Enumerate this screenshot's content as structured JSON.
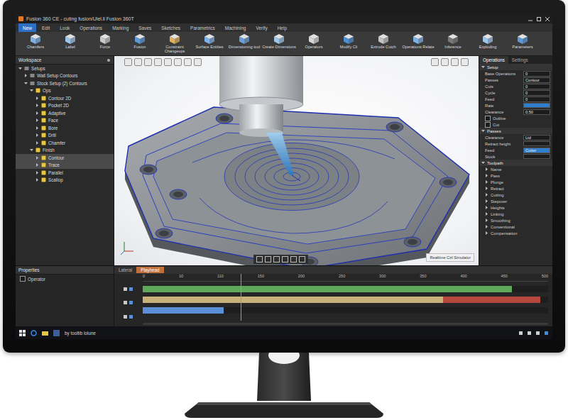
{
  "window": {
    "title": "Fusion 360 CE - cuting fusion/Ulel.ll Fusion 360T"
  },
  "menu": [
    {
      "label": "New",
      "selected": true
    },
    {
      "label": "Edit",
      "selected": false
    },
    {
      "label": "Look",
      "selected": false
    },
    {
      "label": "Operations",
      "selected": false
    },
    {
      "label": "Marking",
      "selected": false
    },
    {
      "label": "Saves",
      "selected": false
    },
    {
      "label": "Sketches",
      "selected": false
    },
    {
      "label": "Parametrics",
      "selected": false
    },
    {
      "label": "Machining",
      "selected": false
    },
    {
      "label": "Verify",
      "selected": false
    },
    {
      "label": "Help",
      "selected": false
    }
  ],
  "ribbon": [
    "Chamfers",
    "Label",
    "Force",
    "Fusion",
    "Constraint Changeups",
    "Surface Entities",
    "Dimensioning tool",
    "Create Dimensions",
    "Operators",
    "Modify Cli",
    "Extrude Cutch",
    "Operations Relate",
    "Inference",
    "Exploding",
    "Parameters"
  ],
  "browser": {
    "title": "Workspace",
    "items": [
      {
        "label": "Setups",
        "kind": "group",
        "level": 0,
        "expanded": true,
        "selected": false
      },
      {
        "label": "Wall Setup Contours",
        "kind": "group",
        "level": 1,
        "expanded": false,
        "selected": false
      },
      {
        "label": "Stock Setup (2) Contours",
        "kind": "group",
        "level": 1,
        "expanded": true,
        "selected": false
      },
      {
        "label": "Ops",
        "kind": "folder",
        "level": 2,
        "expanded": true,
        "selected": false
      },
      {
        "label": "Contour 2D",
        "kind": "op",
        "level": 3,
        "expanded": false,
        "selected": false
      },
      {
        "label": "Pocket 2D",
        "kind": "op",
        "level": 3,
        "expanded": false,
        "selected": false
      },
      {
        "label": "Adaptive",
        "kind": "op",
        "level": 3,
        "expanded": false,
        "selected": false
      },
      {
        "label": "Face",
        "kind": "op",
        "level": 3,
        "expanded": false,
        "selected": false
      },
      {
        "label": "Bore",
        "kind": "op",
        "level": 3,
        "expanded": false,
        "selected": false
      },
      {
        "label": "Drill",
        "kind": "op",
        "level": 3,
        "expanded": false,
        "selected": false
      },
      {
        "label": "Chamfer",
        "kind": "op",
        "level": 3,
        "expanded": false,
        "selected": false
      },
      {
        "label": "Finish",
        "kind": "folder",
        "level": 2,
        "expanded": true,
        "selected": false
      },
      {
        "label": "Contour",
        "kind": "op",
        "level": 3,
        "expanded": false,
        "selected": true
      },
      {
        "label": "Trace",
        "kind": "op",
        "level": 3,
        "expanded": false,
        "selected": true
      },
      {
        "label": "Parallel",
        "kind": "op",
        "level": 3,
        "expanded": false,
        "selected": false
      },
      {
        "label": "Scallop",
        "kind": "op",
        "level": 3,
        "expanded": false,
        "selected": false
      }
    ]
  },
  "viewport": {
    "status": "Realtime Ctrl Simulator"
  },
  "properties": {
    "tabs": [
      {
        "label": "Operations",
        "selected": true
      },
      {
        "label": "Settings",
        "selected": false
      }
    ],
    "sections": [
      {
        "title": "Setup",
        "expanded": true,
        "rows": [
          {
            "label": "Base Operations",
            "kind": "field",
            "value": "0",
            "checked": false
          },
          {
            "label": "Passes",
            "kind": "field",
            "value": "Contour",
            "checked": false
          },
          {
            "label": "Cuts",
            "kind": "field",
            "value": "0",
            "checked": false
          },
          {
            "label": "Cycle",
            "kind": "field",
            "value": "0",
            "checked": false
          },
          {
            "label": "Feed",
            "kind": "field",
            "value": "0",
            "checked": false
          },
          {
            "label": "Rate",
            "kind": "color",
            "value": "",
            "checked": false
          },
          {
            "label": "Clearance",
            "kind": "field",
            "value": "0.50",
            "checked": false
          },
          {
            "label": "Outline",
            "kind": "check",
            "value": "",
            "checked": false
          },
          {
            "label": "Cut",
            "kind": "check",
            "value": "",
            "checked": false
          }
        ]
      },
      {
        "title": "Passes",
        "expanded": true,
        "rows": [
          {
            "label": "Clearance",
            "kind": "field",
            "value": "Ltd",
            "checked": false
          },
          {
            "label": "Retract height",
            "kind": "field",
            "value": "",
            "checked": false
          },
          {
            "label": "Feed",
            "kind": "color",
            "value": "Cutter",
            "checked": false
          },
          {
            "label": "Stock",
            "kind": "field",
            "value": "",
            "checked": false
          }
        ]
      },
      {
        "title": "Toolpath",
        "expanded": true,
        "rows": [
          {
            "label": "Name",
            "kind": "row",
            "value": "",
            "checked": false
          },
          {
            "label": "Pass",
            "kind": "row",
            "value": "",
            "checked": false
          },
          {
            "label": "Plunge",
            "kind": "row",
            "value": "",
            "checked": false
          },
          {
            "label": "Retract",
            "kind": "row",
            "value": "",
            "checked": false
          },
          {
            "label": "Cutting",
            "kind": "row",
            "value": "",
            "checked": false
          },
          {
            "label": "Stepover",
            "kind": "row",
            "value": "",
            "checked": false
          },
          {
            "label": "Heights",
            "kind": "row",
            "value": "",
            "checked": false
          },
          {
            "label": "Linking",
            "kind": "row",
            "value": "",
            "checked": false
          },
          {
            "label": "Smoothing",
            "kind": "row",
            "value": "",
            "checked": false
          },
          {
            "label": "Conventional",
            "kind": "row",
            "value": "",
            "checked": false
          },
          {
            "label": "Compensation",
            "kind": "row",
            "value": "",
            "checked": false
          }
        ]
      }
    ]
  },
  "timeline": {
    "title": "Properties",
    "items": [
      {
        "label": "Operator",
        "checked": false
      }
    ],
    "tabs": [
      {
        "label": "Lateral",
        "selected": false
      },
      {
        "label": "Playhead",
        "selected": true
      }
    ],
    "ticks": [
      "0",
      "10",
      "110",
      "150",
      "200",
      "250",
      "300",
      "350",
      "400",
      "450",
      "500"
    ],
    "playhead": 0.24,
    "rows": [
      {
        "segments": [
          {
            "start": 0,
            "end": 0.91,
            "color": "#5fa85a"
          }
        ]
      },
      {
        "segments": [
          {
            "start": 0,
            "end": 0.74,
            "color": "#c9b27a"
          },
          {
            "start": 0.74,
            "end": 0.98,
            "color": "#b5473f"
          }
        ]
      },
      {
        "segments": [
          {
            "start": 0,
            "end": 0.2,
            "color": "#5b8fd6"
          }
        ]
      }
    ]
  },
  "taskbar": {
    "label": "by tooltib lolune"
  }
}
